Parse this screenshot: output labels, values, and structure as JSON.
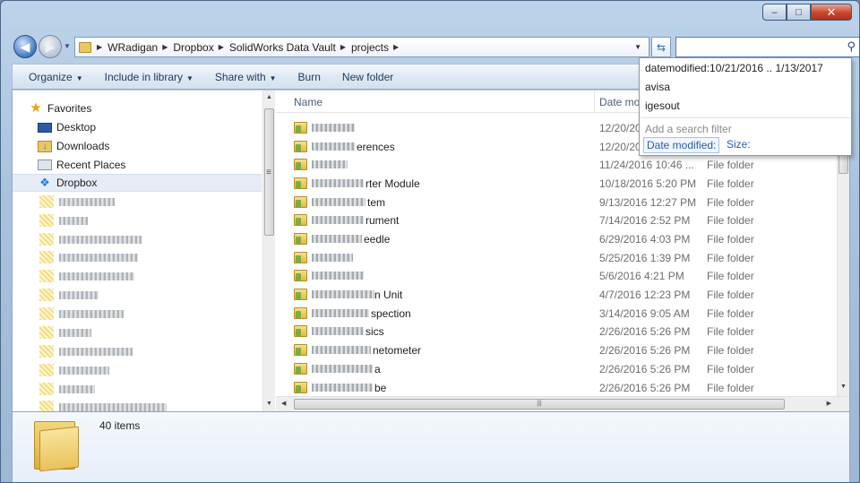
{
  "window": {
    "caption": {
      "minimize": "‒",
      "maximize": "□",
      "close": "✕"
    }
  },
  "address_bar": {
    "breadcrumbs": [
      "WRadigan",
      "Dropbox",
      "SolidWorks Data Vault",
      "projects"
    ]
  },
  "search": {
    "value": "",
    "icon": "search-icon",
    "suggestions": [
      "datemodified:10/21/2016 .. 1/13/2017",
      "avisa",
      "igesout"
    ],
    "hint": "Add a search filter",
    "filters": [
      "Date modified:",
      "Size:"
    ]
  },
  "toolbar": {
    "organize": "Organize",
    "include_in_library": "Include in library",
    "share_with": "Share with",
    "burn": "Burn",
    "new_folder": "New folder"
  },
  "nav": {
    "favorites": "Favorites",
    "desktop": "Desktop",
    "downloads": "Downloads",
    "recent_places": "Recent Places",
    "dropbox": "Dropbox"
  },
  "columns": {
    "name": "Name",
    "date": "Date mo"
  },
  "files": [
    {
      "name": "",
      "date": "12/20/20",
      "type": ""
    },
    {
      "name": "erences",
      "date": "12/20/20",
      "type": ""
    },
    {
      "name": "",
      "date": "11/24/2016 10:46 ...",
      "type": "File folder"
    },
    {
      "name": "rter Module",
      "date": "10/18/2016 5:20 PM",
      "type": "File folder"
    },
    {
      "name": "tem",
      "date": "9/13/2016 12:27 PM",
      "type": "File folder"
    },
    {
      "name": "rument",
      "date": "7/14/2016 2:52 PM",
      "type": "File folder"
    },
    {
      "name": "eedle",
      "date": "6/29/2016 4:03 PM",
      "type": "File folder"
    },
    {
      "name": "",
      "date": "5/25/2016 1:39 PM",
      "type": "File folder"
    },
    {
      "name": "",
      "date": "5/6/2016 4:21 PM",
      "type": "File folder"
    },
    {
      "name": "n Unit",
      "date": "4/7/2016 12:23 PM",
      "type": "File folder"
    },
    {
      "name": "spection",
      "date": "3/14/2016 9:05 AM",
      "type": "File folder"
    },
    {
      "name": "sics",
      "date": "2/26/2016 5:26 PM",
      "type": "File folder"
    },
    {
      "name": "netometer",
      "date": "2/26/2016 5:26 PM",
      "type": "File folder"
    },
    {
      "name": "a",
      "date": "2/26/2016 5:26 PM",
      "type": "File folder"
    },
    {
      "name": "be",
      "date": "2/26/2016 5:26 PM",
      "type": "File folder"
    }
  ],
  "details": {
    "count": "40 items"
  }
}
